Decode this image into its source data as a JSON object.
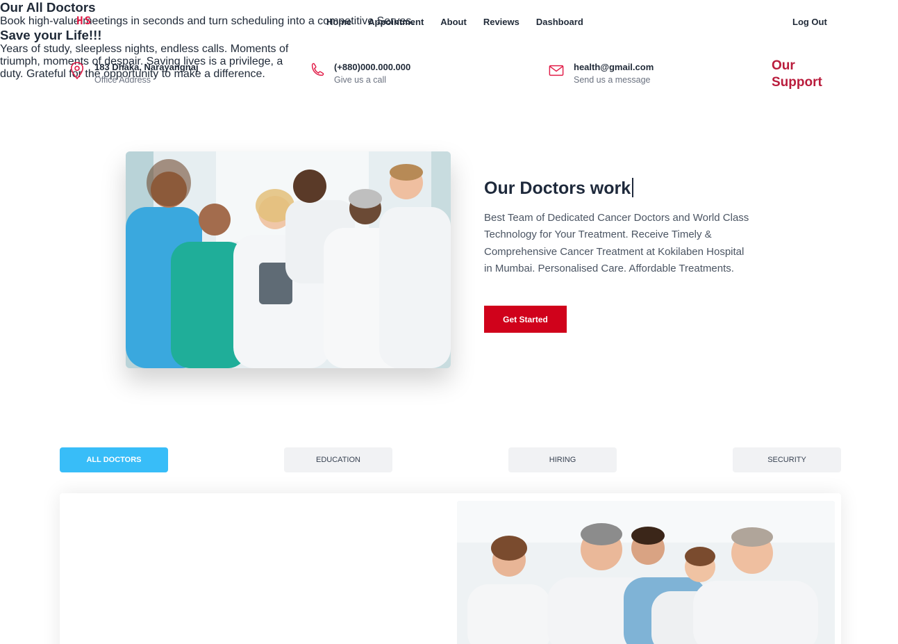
{
  "logo": {
    "text": "HS"
  },
  "nav": {
    "items": [
      {
        "label": "Home"
      },
      {
        "label": "Appointment"
      },
      {
        "label": "About"
      },
      {
        "label": "Reviews"
      },
      {
        "label": "Dashboard"
      }
    ],
    "logout_label": "Log Out"
  },
  "contact": {
    "address": {
      "title": "183 Dhaka, Narayangnaj",
      "subtitle": "Office Address",
      "icon": "location-pin-icon"
    },
    "phone": {
      "title": "(+880)000.000.000",
      "subtitle": "Give us a call",
      "icon": "phone-icon"
    },
    "email": {
      "title": "health@gmail.com",
      "subtitle": "Send us a message",
      "icon": "mail-icon"
    },
    "support_line1": "Our",
    "support_line2": "Support"
  },
  "hero": {
    "title": "Our Doctors work",
    "description": "Best Team of Dedicated Cancer Doctors and World Class Technology for Your Treatment. Receive Timely & Comprehensive Cancer Treatment at Kokilaben Hospital in Mumbai. Personalised Care. Affordable Treatments.",
    "cta_label": "Get Started"
  },
  "tabs": [
    {
      "label": "ALL DOCTORS",
      "active": true
    },
    {
      "label": "EDUCATION",
      "active": false
    },
    {
      "label": "HIRING",
      "active": false
    },
    {
      "label": "SECURITY",
      "active": false
    }
  ],
  "card": {
    "heading1": "Our All Doctors",
    "text1": "Book high-value meetings in seconds and turn scheduling into a competitive Serves.",
    "heading2": "Save your Life!!!",
    "text2": "Years of study, sleepless nights, endless calls. Moments of triumph, moments of despair. Saving lives is a privilege, a duty. Grateful for the opportunity to make a difference."
  },
  "colors": {
    "brand_red": "#d0021b",
    "support_red": "#b91c3c",
    "active_tab": "#38bdf8",
    "logo": "#e11d48"
  }
}
